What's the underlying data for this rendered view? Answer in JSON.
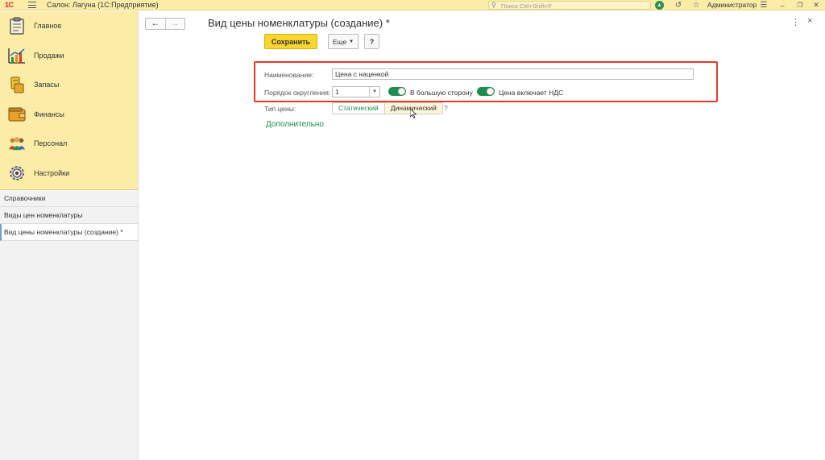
{
  "titlebar": {
    "logo": "1С",
    "title": "Салон: Лагуна  (1С:Предприятие)",
    "search_placeholder": "Поиск Ctrl+Shift+F",
    "user": "Администратор"
  },
  "sidebar": {
    "sections": [
      {
        "label": "Главное",
        "icon": "clipboard-icon"
      },
      {
        "label": "Продажи",
        "icon": "sales-chart-icon"
      },
      {
        "label": "Запасы",
        "icon": "stock-icon"
      },
      {
        "label": "Финансы",
        "icon": "wallet-icon"
      },
      {
        "label": "Персонал",
        "icon": "people-icon"
      },
      {
        "label": "Настройки",
        "icon": "gear-icon"
      }
    ],
    "nav": [
      {
        "label": "Справочники"
      },
      {
        "label": "Виды цен номенклатуры"
      },
      {
        "label": "Вид цены номенклатуры (создание) *"
      }
    ]
  },
  "form": {
    "title": "Вид цены номенклатуры (создание) *",
    "save_label": "Сохранить",
    "more_label": "Еще",
    "help_label": "?",
    "name_label": "Наименование:",
    "name_value": "Цена с наценкой",
    "rounding_label": "Порядок округления:",
    "rounding_value": "1",
    "round_up_label": "В большую сторону",
    "round_up_on": true,
    "vat_label": "Цена включает НДС",
    "vat_on": true,
    "price_type_label": "Тип цены:",
    "price_type_options": [
      "Статический",
      "Динамический"
    ],
    "price_type_help": "?",
    "additional_label": "Дополнительно"
  },
  "colors": {
    "titlebar_bg": "#fbeda7",
    "accent_green": "#1e8d4d",
    "save_yellow": "#f9d531",
    "highlight_red": "#e6392c"
  }
}
